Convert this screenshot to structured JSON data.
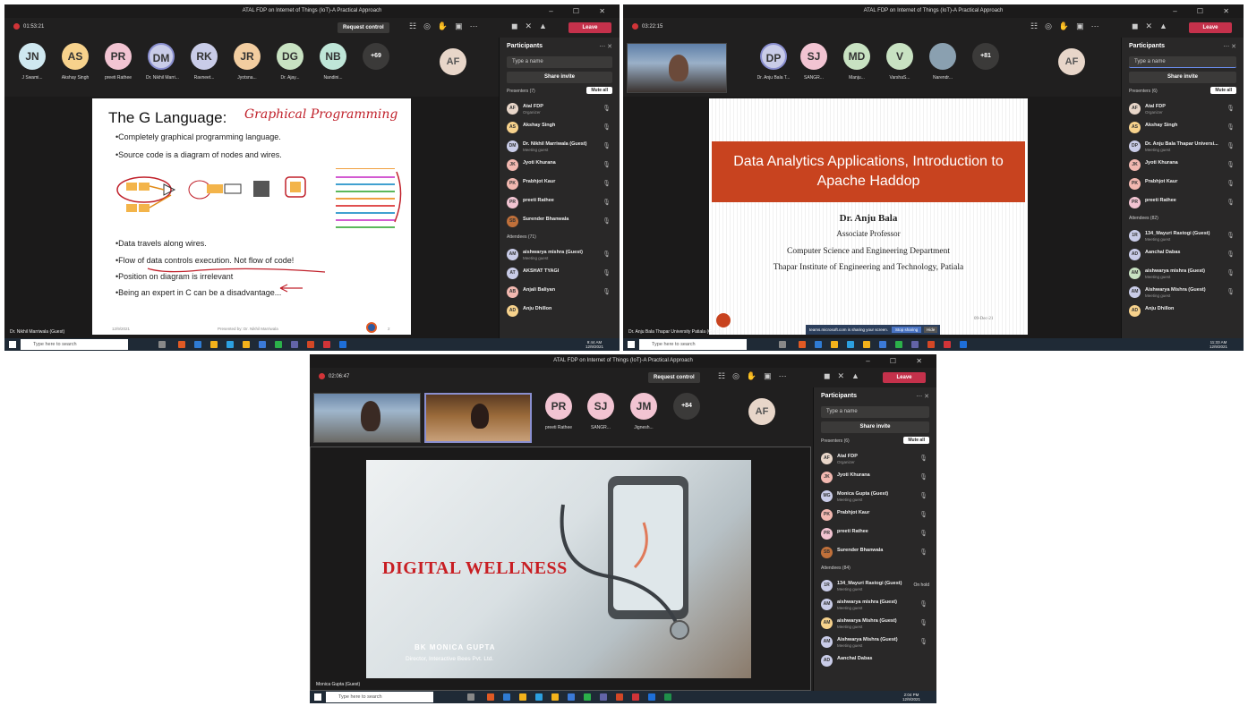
{
  "window_title": "ATAL FDP on Internet of Things (IoT)-A Practical Approach",
  "window_controls": "– ☐ ✕",
  "common": {
    "request_control": "Request control",
    "leave": "Leave",
    "participants_title": "Participants",
    "search_placeholder": "Type a name",
    "share_invite": "Share invite",
    "mute_all": "Mute all",
    "taskbar_search": "Type here to search",
    "af_initials": "AF",
    "organizer": "Organizer",
    "meeting_guest": "Meeting guest"
  },
  "shot1": {
    "timer": "01:53:21",
    "avatars": [
      {
        "initials": "JN",
        "name": "J Swami...",
        "color": "#cfe8f0"
      },
      {
        "initials": "AS",
        "name": "Akshay Singh",
        "color": "#f7d28c"
      },
      {
        "initials": "PR",
        "name": "preeti Rathee",
        "color": "#f2c4d2"
      },
      {
        "initials": "DM",
        "name": "Dr. Nikhil Marri...",
        "color": "#c9cce8"
      },
      {
        "initials": "RK",
        "name": "Ravneet...",
        "color": "#c9cce8"
      },
      {
        "initials": "JR",
        "name": "Jyotsna...",
        "color": "#f2cda0"
      },
      {
        "initials": "DG",
        "name": "Dr. Ajay...",
        "color": "#c8e2c2"
      },
      {
        "initials": "NB",
        "name": "Nandini...",
        "color": "#bfe6d8"
      },
      {
        "initials": "+69",
        "name": "",
        "color": "#3b3a39"
      }
    ],
    "presenters_label": "Presenters (7)",
    "presenters": [
      {
        "name": "Atal FDP",
        "sub": "Organizer",
        "initials": "AF",
        "color": "#e8d6c9"
      },
      {
        "name": "Akshay Singh",
        "sub": "",
        "initials": "AS",
        "color": "#f7d28c"
      },
      {
        "name": "Dr. Nikhil Marriwala (Guest)",
        "sub": "Meeting guest",
        "initials": "DM",
        "color": "#c9cce8"
      },
      {
        "name": "Jyoti Khurana",
        "sub": "",
        "initials": "JK",
        "color": "#f2b8b0"
      },
      {
        "name": "Prabhjot Kaur",
        "sub": "",
        "initials": "PK",
        "color": "#f2b8b0"
      },
      {
        "name": "preeti Rathee",
        "sub": "",
        "initials": "PR",
        "color": "#f2c4d2"
      },
      {
        "name": "Surender Bhanwala",
        "sub": "",
        "initials": "SB",
        "color": "#c0703a"
      }
    ],
    "attendees_label": "Attendees (71)",
    "attendees": [
      {
        "name": "aishwarya mishra (Guest)",
        "sub": "Meeting guest",
        "initials": "AM",
        "color": "#c9cce8"
      },
      {
        "name": "AKSHAT TYAGI",
        "sub": "",
        "initials": "AT",
        "color": "#c9cce8"
      },
      {
        "name": "Anjali Baliyan",
        "sub": "",
        "initials": "AB",
        "color": "#f2b8b0"
      },
      {
        "name": "Anju Dhillon",
        "sub": "",
        "initials": "AD",
        "color": "#f7d28c"
      }
    ],
    "slide": {
      "title": "The G Language:",
      "handwritten": "Graphical Programming",
      "bullets_top": [
        "•Completely graphical programming language.",
        "•Source code is a diagram of nodes and wires."
      ],
      "bullets_bottom": [
        "•Data travels along wires.",
        "•Flow of data controls execution. Not flow of code!",
        "•Position on diagram is irrelevant",
        "•Being an expert in C can be a disadvantage..."
      ],
      "footer_date": "12/9/2021",
      "footer_presenter": "Presented by: Dr. Nikhil Marriwala",
      "page": "2"
    },
    "caption": "Dr. Nikhil Marriwala (Guest)",
    "clock_time": "9:44 AM",
    "clock_date": "12/9/2021"
  },
  "shot2": {
    "timer": "03:22:15",
    "avatars": [
      {
        "initials": "DP",
        "name": "Dr. Anju Bala T...",
        "color": "#c9cce8"
      },
      {
        "initials": "SJ",
        "name": "SANGR...",
        "color": "#f2c4d2"
      },
      {
        "initials": "MD",
        "name": "Manju...",
        "color": "#c8e2c2"
      },
      {
        "initials": "V",
        "name": "VarshaS...",
        "color": "#c8e2c2"
      },
      {
        "initials": "",
        "name": "Narendr...",
        "color": "#8aa0b0"
      },
      {
        "initials": "+81",
        "name": "",
        "color": "#3b3a39"
      }
    ],
    "presenters_label": "Presenters (6)",
    "presenters": [
      {
        "name": "Atal FDP",
        "sub": "Organizer",
        "initials": "AF",
        "color": "#e8d6c9"
      },
      {
        "name": "Akshay Singh",
        "sub": "",
        "initials": "AS",
        "color": "#f7d28c"
      },
      {
        "name": "Dr. Anju Bala Thapar Universi...",
        "sub": "Meeting guest",
        "initials": "DP",
        "color": "#c9cce8"
      },
      {
        "name": "Jyoti Khurana",
        "sub": "",
        "initials": "JK",
        "color": "#f2b8b0"
      },
      {
        "name": "Prabhjot Kaur",
        "sub": "",
        "initials": "PK",
        "color": "#f2b8b0"
      },
      {
        "name": "preeti Rathee",
        "sub": "",
        "initials": "PR",
        "color": "#f2c4d2"
      }
    ],
    "attendees_label": "Attendees (82)",
    "attendees": [
      {
        "name": "134_Mayuri Rastogi (Guest)",
        "sub": "Meeting guest",
        "initials": "1R",
        "color": "#c9cce8"
      },
      {
        "name": "Aanchal Dabas",
        "sub": "",
        "initials": "AD",
        "color": "#c9cce8"
      },
      {
        "name": "aishwarya mishra (Guest)",
        "sub": "Meeting guest",
        "initials": "AM",
        "color": "#c8e2c2"
      },
      {
        "name": "Aishwarya Mishra (Guest)",
        "sub": "Meeting guest",
        "initials": "AM",
        "color": "#c9cce8"
      },
      {
        "name": "Anju Dhillon",
        "sub": "",
        "initials": "AD",
        "color": "#f7d28c"
      }
    ],
    "slide": {
      "band": "Data Analytics Applications, Introduction to Apache Haddop",
      "name": "Dr. Anju Bala",
      "role": "Associate Professor",
      "dept": "Computer Science and Engineering Department",
      "inst": "Thapar Institute of Engineering and Technology,  Patiala",
      "date": "09-Dec-21"
    },
    "share_bar": "teams.microsoft.com is sharing your screen.",
    "stop_sharing": "Stop sharing",
    "hide": "Hide",
    "caption": "Dr. Anju Bala Thapar University Patiala (Guest)",
    "clock_time": "11:33 AM",
    "clock_date": "12/9/2021"
  },
  "shot3": {
    "timer": "02:06:47",
    "avatars": [
      {
        "initials": "PR",
        "name": "preeti Rathee",
        "color": "#f2c4d2"
      },
      {
        "initials": "SJ",
        "name": "SANGR...",
        "color": "#f2c4d2"
      },
      {
        "initials": "JM",
        "name": "Jignesh...",
        "color": "#f2c4d2"
      },
      {
        "initials": "+84",
        "name": "",
        "color": "#3b3a39"
      }
    ],
    "presenters_label": "Presenters (6)",
    "presenters": [
      {
        "name": "Atal FDP",
        "sub": "Organizer",
        "initials": "AF",
        "color": "#e8d6c9"
      },
      {
        "name": "Jyoti Khurana",
        "sub": "",
        "initials": "JK",
        "color": "#f2b8b0"
      },
      {
        "name": "Monica Gupta (Guest)",
        "sub": "Meeting guest",
        "initials": "MG",
        "color": "#c9cce8"
      },
      {
        "name": "Prabhjot Kaur",
        "sub": "",
        "initials": "PK",
        "color": "#f2b8b0"
      },
      {
        "name": "preeti Rathee",
        "sub": "",
        "initials": "PR",
        "color": "#f2c4d2"
      },
      {
        "name": "Surender Bhanwala",
        "sub": "",
        "initials": "SB",
        "color": "#c0703a"
      }
    ],
    "attendees_label": "Attendees (84)",
    "attendees": [
      {
        "name": "134_Mayuri Rastogi (Guest)",
        "sub": "Meeting guest",
        "initials": "1R",
        "color": "#c9cce8",
        "note": "On hold"
      },
      {
        "name": "aishwarya mishra (Guest)",
        "sub": "Meeting guest",
        "initials": "AM",
        "color": "#c9cce8"
      },
      {
        "name": "aishwarya Mishra (Guest)",
        "sub": "Meeting guest",
        "initials": "AM",
        "color": "#f7d28c"
      },
      {
        "name": "Aishwarya Mishra (Guest)",
        "sub": "Meeting guest",
        "initials": "AM",
        "color": "#c9cce8"
      },
      {
        "name": "Aanchal Dabas",
        "sub": "",
        "initials": "AD",
        "color": "#c9cce8"
      }
    ],
    "slide": {
      "title": "DIGITAL WELLNESS",
      "name": "BK MONICA GUPTA",
      "role": "Director, Interactive Bees Pvt. Ltd."
    },
    "caption": "Monica Gupta (Guest)",
    "clock_time": "2:04 PM",
    "clock_date": "12/9/2021"
  }
}
